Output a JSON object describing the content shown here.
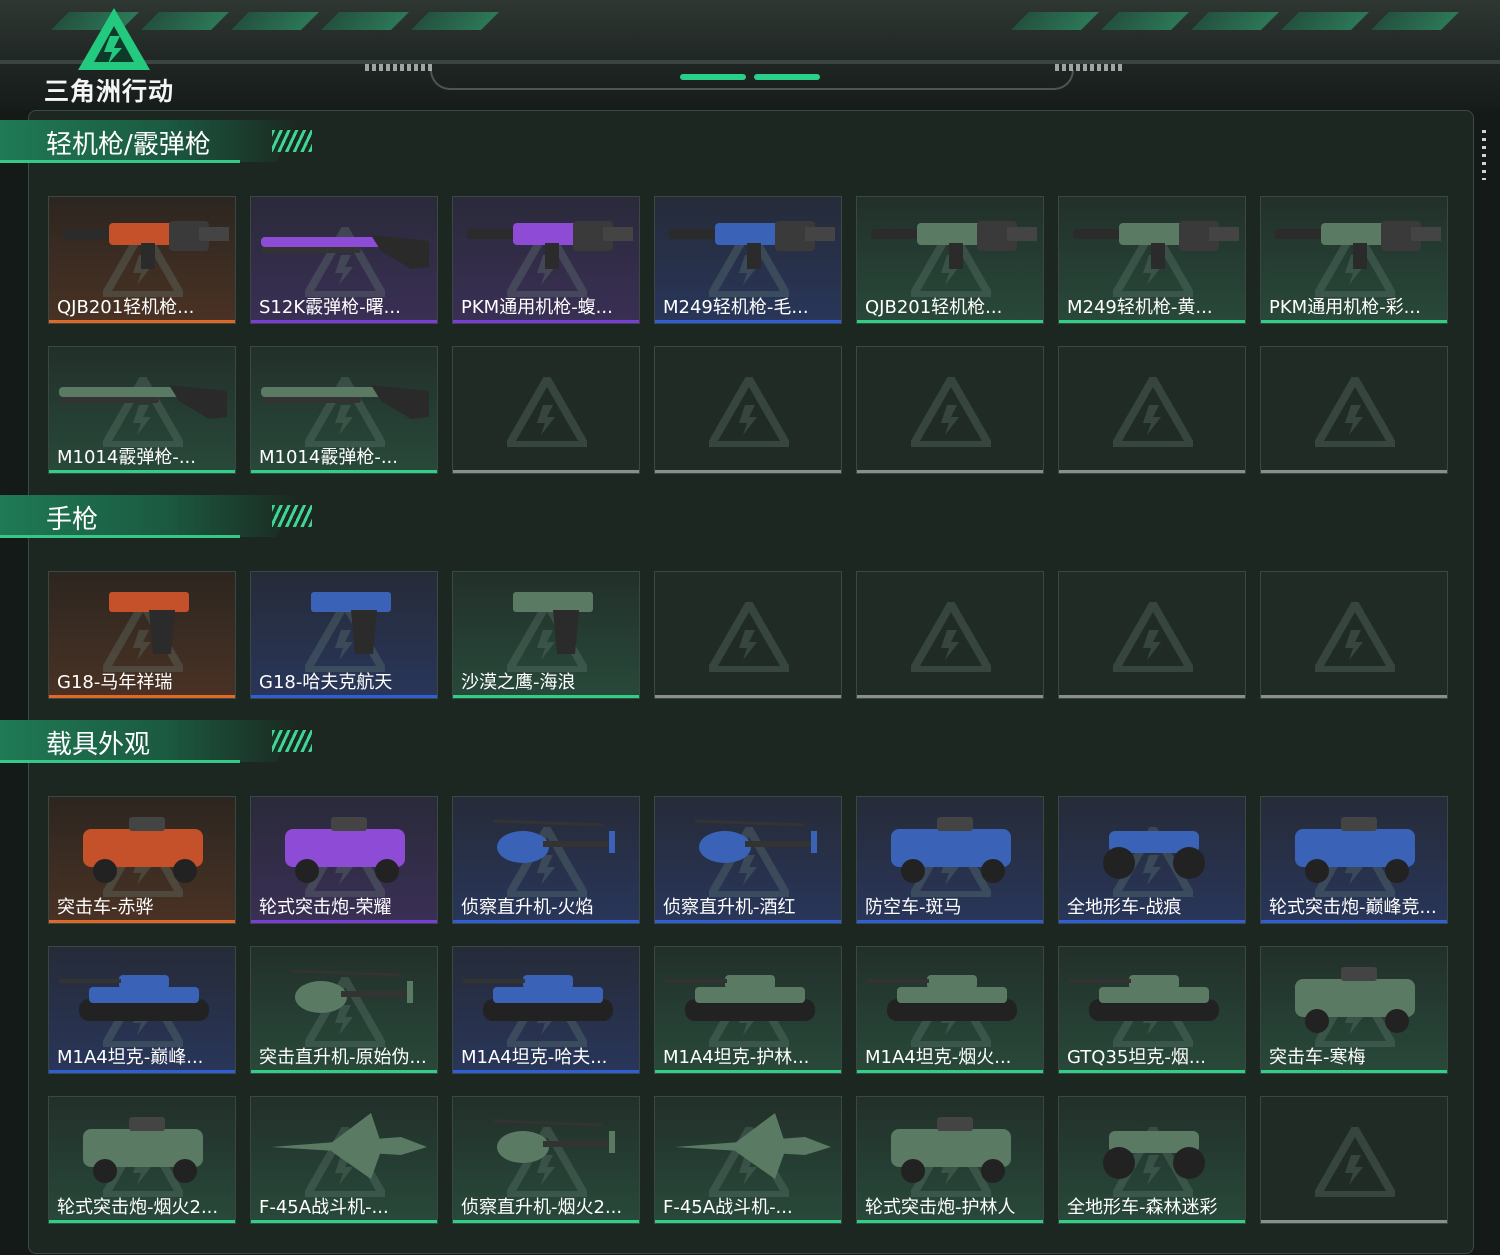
{
  "app": {
    "logo_text": "三角洲行动"
  },
  "colors": {
    "orange": "#e0692a",
    "purple": "#7a3bd8",
    "blue": "#2e5fd6",
    "green": "#2fcf85",
    "grey": "#8a8f8c"
  },
  "sections": [
    {
      "title": "轻机枪/霰弹枪",
      "items": [
        {
          "label": "QJB201轻机枪...",
          "rarity": "orange",
          "icon": "lmg-icon"
        },
        {
          "label": "S12K霰弹枪-曙...",
          "rarity": "purple",
          "icon": "shotgun-icon"
        },
        {
          "label": "PKM通用机枪-蝮...",
          "rarity": "purple",
          "icon": "lmg-icon"
        },
        {
          "label": "M249轻机枪-毛...",
          "rarity": "blue",
          "icon": "lmg-icon"
        },
        {
          "label": "QJB201轻机枪...",
          "rarity": "green",
          "icon": "lmg-icon"
        },
        {
          "label": "M249轻机枪-黄...",
          "rarity": "green",
          "icon": "lmg-icon"
        },
        {
          "label": "PKM通用机枪-彩...",
          "rarity": "green",
          "icon": "lmg-icon"
        },
        {
          "label": "M1014霰弹枪-...",
          "rarity": "green",
          "icon": "shotgun-icon"
        },
        {
          "label": "M1014霰弹枪-...",
          "rarity": "green",
          "icon": "shotgun-icon"
        },
        {
          "label": "",
          "rarity": "empty"
        },
        {
          "label": "",
          "rarity": "empty"
        },
        {
          "label": "",
          "rarity": "empty"
        },
        {
          "label": "",
          "rarity": "empty"
        },
        {
          "label": "",
          "rarity": "empty"
        }
      ]
    },
    {
      "title": "手枪",
      "items": [
        {
          "label": "G18-马年祥瑞",
          "rarity": "orange",
          "icon": "pistol-icon"
        },
        {
          "label": "G18-哈夫克航天",
          "rarity": "blue",
          "icon": "pistol-icon"
        },
        {
          "label": "沙漠之鹰-海浪",
          "rarity": "green",
          "icon": "pistol-icon"
        },
        {
          "label": "",
          "rarity": "empty"
        },
        {
          "label": "",
          "rarity": "empty"
        },
        {
          "label": "",
          "rarity": "empty"
        },
        {
          "label": "",
          "rarity": "empty"
        }
      ]
    },
    {
      "title": "载具外观",
      "items": [
        {
          "label": "突击车-赤骅",
          "rarity": "orange",
          "icon": "armored-car-icon"
        },
        {
          "label": "轮式突击炮-荣耀",
          "rarity": "purple",
          "icon": "armored-car-icon"
        },
        {
          "label": "侦察直升机-火焰",
          "rarity": "blue",
          "icon": "helicopter-icon"
        },
        {
          "label": "侦察直升机-酒红",
          "rarity": "blue",
          "icon": "helicopter-icon"
        },
        {
          "label": "防空车-斑马",
          "rarity": "blue",
          "icon": "armored-car-icon"
        },
        {
          "label": "全地形车-战痕",
          "rarity": "blue",
          "icon": "atv-icon"
        },
        {
          "label": "轮式突击炮-巅峰竞...",
          "rarity": "blue",
          "icon": "armored-car-icon"
        },
        {
          "label": "M1A4坦克-巅峰...",
          "rarity": "blue",
          "icon": "tank-icon"
        },
        {
          "label": "突击直升机-原始伪...",
          "rarity": "green",
          "icon": "helicopter-icon"
        },
        {
          "label": "M1A4坦克-哈夫...",
          "rarity": "blue",
          "icon": "tank-icon"
        },
        {
          "label": "M1A4坦克-护林...",
          "rarity": "green",
          "icon": "tank-icon"
        },
        {
          "label": "M1A4坦克-烟火...",
          "rarity": "green",
          "icon": "tank-icon"
        },
        {
          "label": "GTQ35坦克-烟...",
          "rarity": "green",
          "icon": "tank-icon"
        },
        {
          "label": "突击车-寒梅",
          "rarity": "green",
          "icon": "armored-car-icon"
        },
        {
          "label": "轮式突击炮-烟火2...",
          "rarity": "green",
          "icon": "armored-car-icon"
        },
        {
          "label": "F-45A战斗机-...",
          "rarity": "green",
          "icon": "jet-icon"
        },
        {
          "label": "侦察直升机-烟火2...",
          "rarity": "green",
          "icon": "helicopter-icon"
        },
        {
          "label": "F-45A战斗机-...",
          "rarity": "green",
          "icon": "jet-icon"
        },
        {
          "label": "轮式突击炮-护林人",
          "rarity": "green",
          "icon": "armored-car-icon"
        },
        {
          "label": "全地形车-森林迷彩",
          "rarity": "green",
          "icon": "atv-icon"
        },
        {
          "label": "",
          "rarity": "empty"
        }
      ]
    }
  ]
}
